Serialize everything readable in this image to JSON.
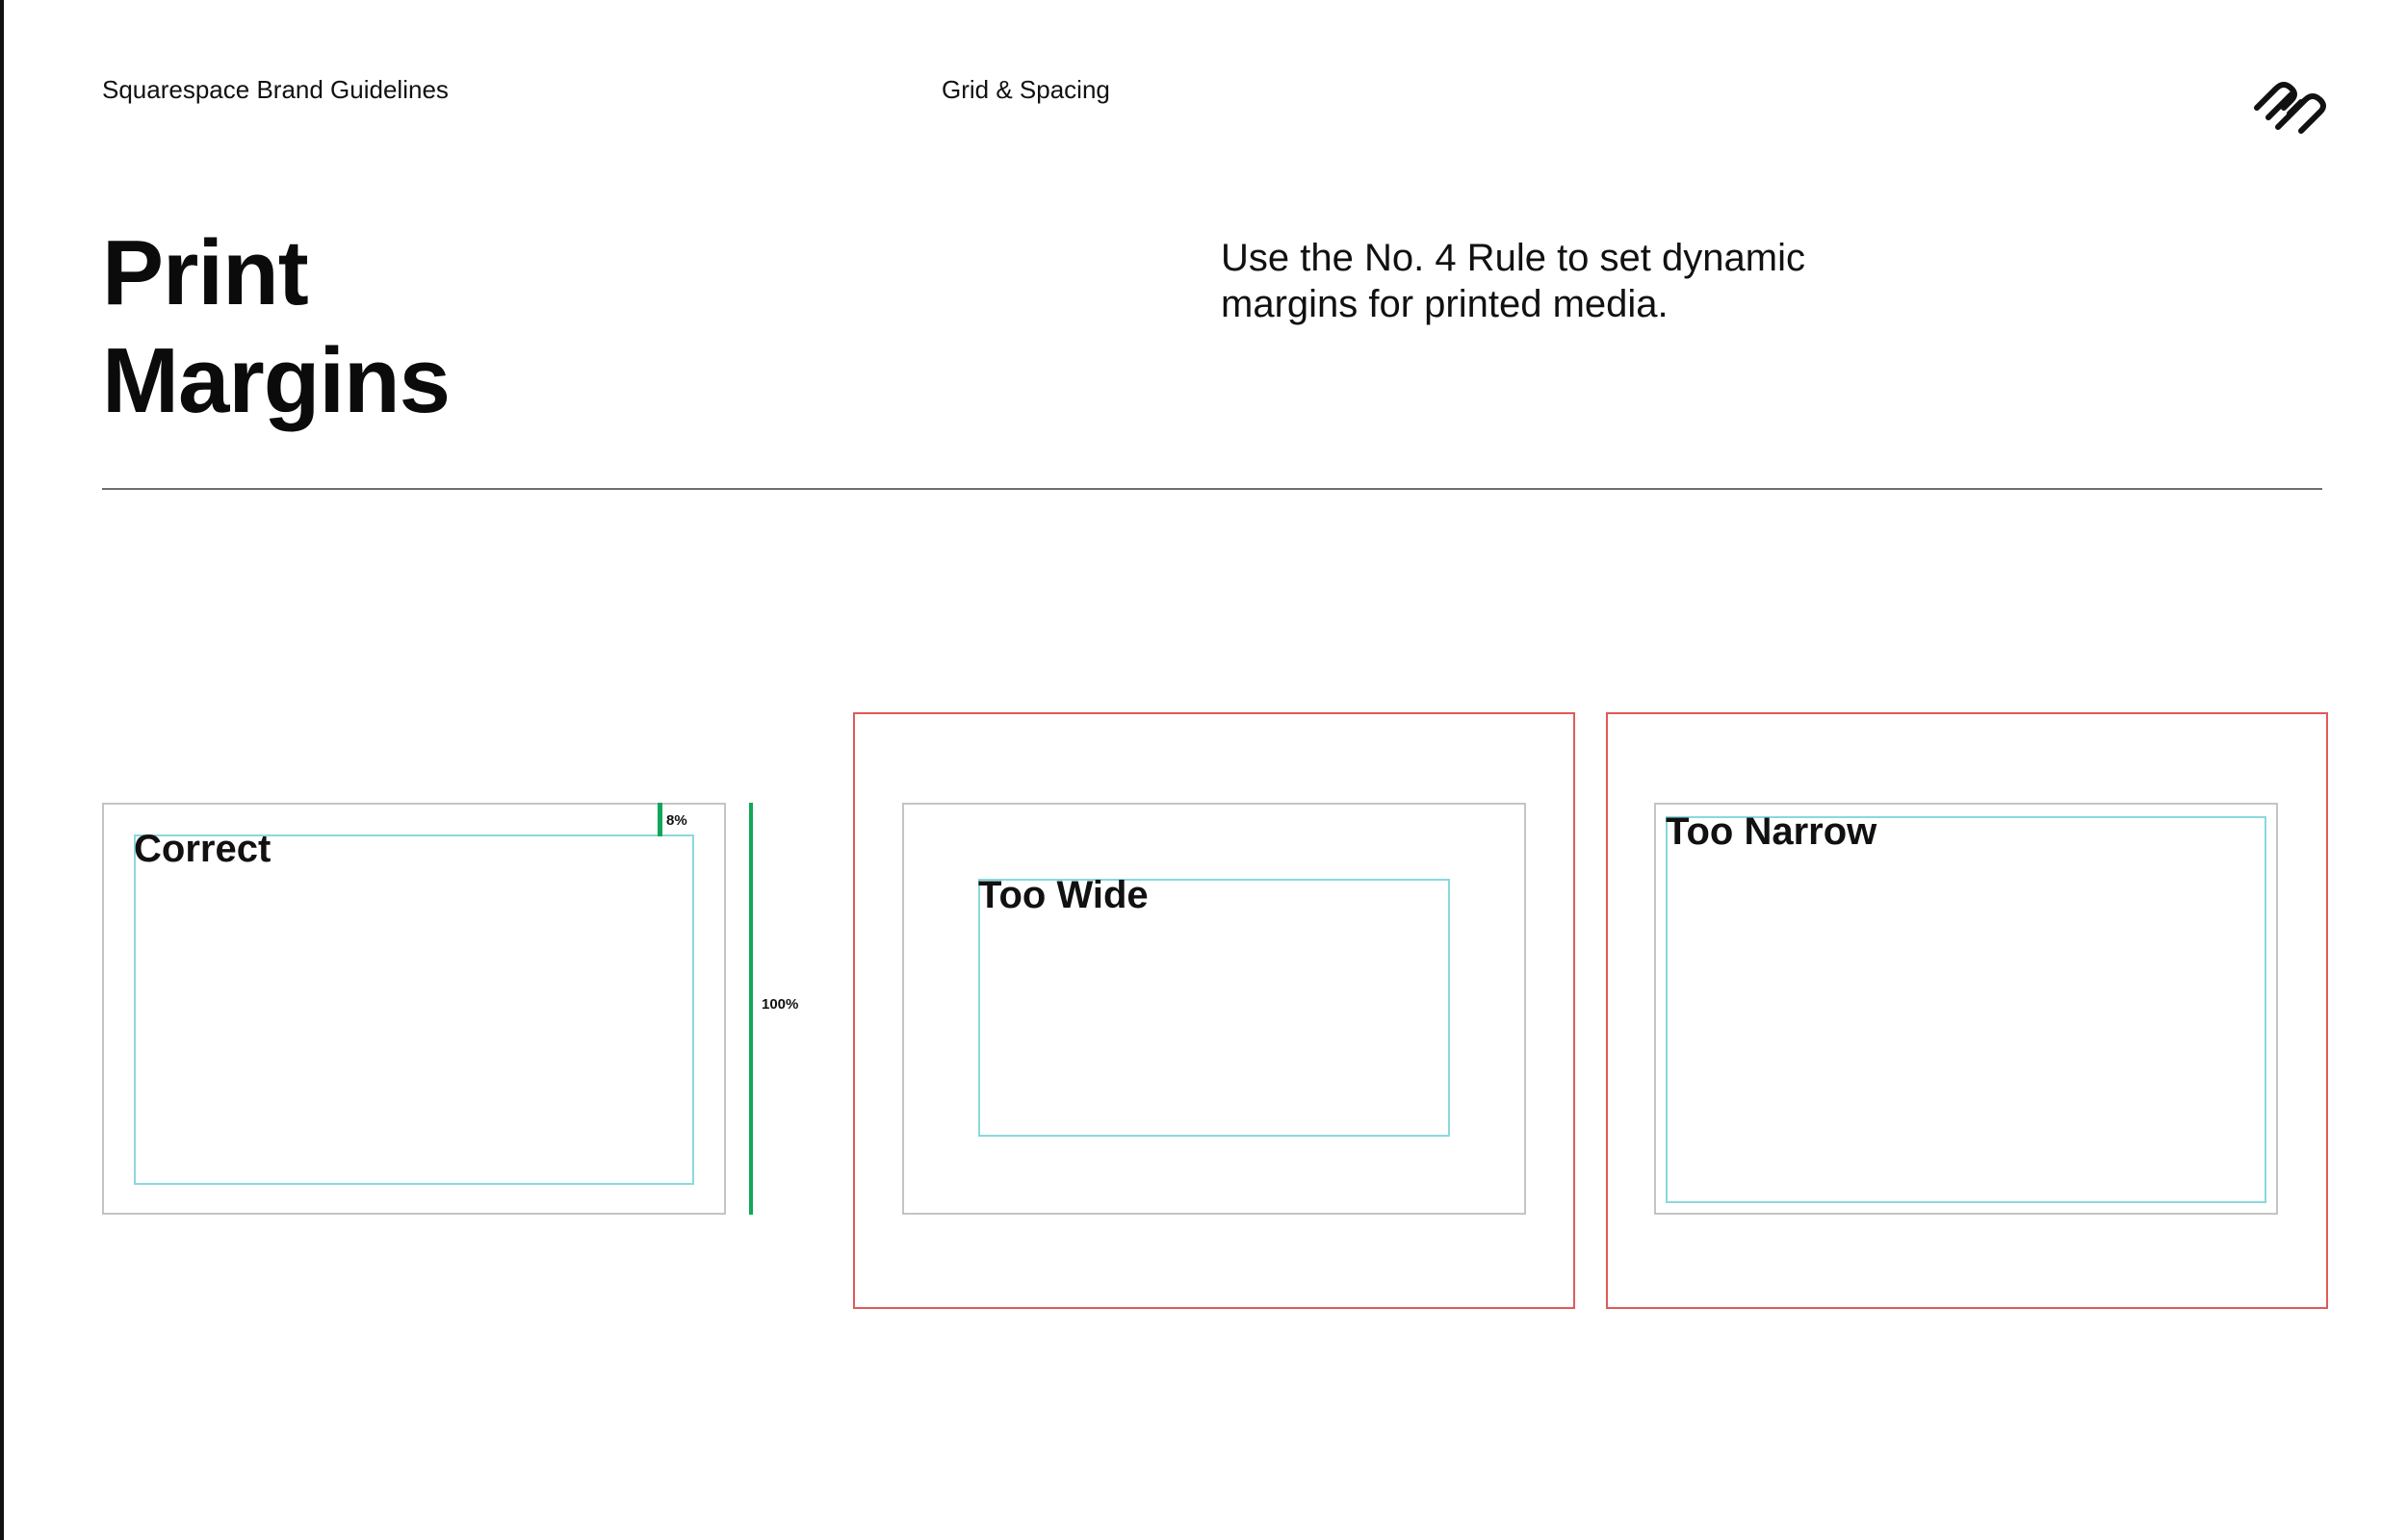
{
  "header": {
    "brand": "Squarespace Brand Guidelines",
    "section": "Grid & Spacing",
    "logo_icon": "squarespace-logo-icon"
  },
  "page": {
    "title_line1": "Print",
    "title_line2": "Margins",
    "intro_line1": "Use the No. 4 Rule to set dynamic",
    "intro_line2": "margins for printed media."
  },
  "examples": {
    "correct": {
      "label": "Correct",
      "margin_label": "8%",
      "height_label": "100%"
    },
    "too_wide": {
      "label": "Too Wide"
    },
    "too_narrow": {
      "label": "Too Narrow"
    }
  },
  "colors": {
    "text": "#111111",
    "divider": "#6e6e6e",
    "page_border": "#c4c4c4",
    "safe_area": "#8ad8de",
    "incorrect_frame": "#e05a5a",
    "measure": "#12a65a"
  }
}
